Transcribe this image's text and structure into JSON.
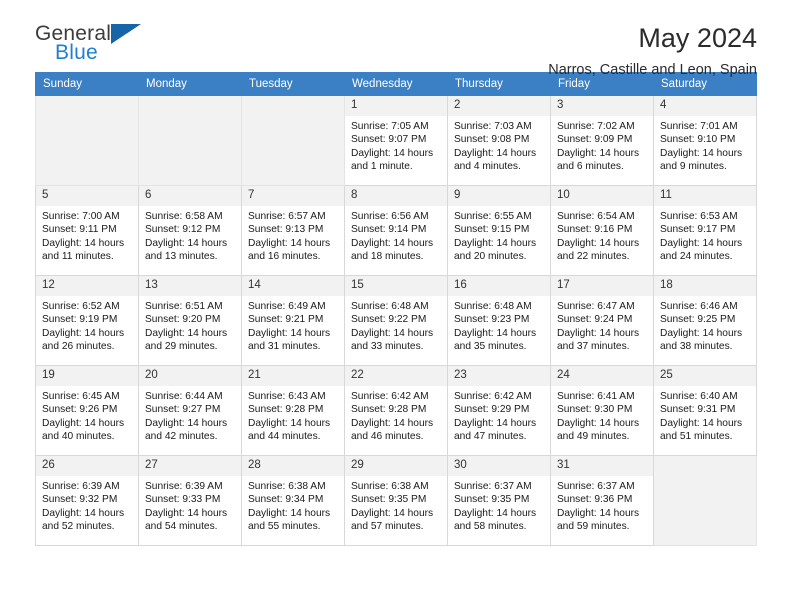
{
  "brand": {
    "name_part1": "General",
    "name_part2": "Blue",
    "logo_icon": "triangle-flag-icon",
    "accent_color": "#1f7fd0",
    "triangle_color": "#1565a8"
  },
  "header": {
    "title": "May 2024",
    "subtitle": "Narros, Castille and Leon, Spain"
  },
  "theme": {
    "header_row_bg": "#3b7fc4",
    "daynum_bg": "#f2f2f2",
    "grid_border": "#d8d8d8"
  },
  "weekday_headers": [
    "Sunday",
    "Monday",
    "Tuesday",
    "Wednesday",
    "Thursday",
    "Friday",
    "Saturday"
  ],
  "weeks": [
    [
      {
        "day": "",
        "empty": true,
        "sunrise": "",
        "sunset": "",
        "daylight_line1": "",
        "daylight_line2": ""
      },
      {
        "day": "",
        "empty": true,
        "sunrise": "",
        "sunset": "",
        "daylight_line1": "",
        "daylight_line2": ""
      },
      {
        "day": "",
        "empty": true,
        "sunrise": "",
        "sunset": "",
        "daylight_line1": "",
        "daylight_line2": ""
      },
      {
        "day": "1",
        "empty": false,
        "sunrise": "Sunrise: 7:05 AM",
        "sunset": "Sunset: 9:07 PM",
        "daylight_line1": "Daylight: 14 hours",
        "daylight_line2": "and 1 minute."
      },
      {
        "day": "2",
        "empty": false,
        "sunrise": "Sunrise: 7:03 AM",
        "sunset": "Sunset: 9:08 PM",
        "daylight_line1": "Daylight: 14 hours",
        "daylight_line2": "and 4 minutes."
      },
      {
        "day": "3",
        "empty": false,
        "sunrise": "Sunrise: 7:02 AM",
        "sunset": "Sunset: 9:09 PM",
        "daylight_line1": "Daylight: 14 hours",
        "daylight_line2": "and 6 minutes."
      },
      {
        "day": "4",
        "empty": false,
        "sunrise": "Sunrise: 7:01 AM",
        "sunset": "Sunset: 9:10 PM",
        "daylight_line1": "Daylight: 14 hours",
        "daylight_line2": "and 9 minutes."
      }
    ],
    [
      {
        "day": "5",
        "empty": false,
        "sunrise": "Sunrise: 7:00 AM",
        "sunset": "Sunset: 9:11 PM",
        "daylight_line1": "Daylight: 14 hours",
        "daylight_line2": "and 11 minutes."
      },
      {
        "day": "6",
        "empty": false,
        "sunrise": "Sunrise: 6:58 AM",
        "sunset": "Sunset: 9:12 PM",
        "daylight_line1": "Daylight: 14 hours",
        "daylight_line2": "and 13 minutes."
      },
      {
        "day": "7",
        "empty": false,
        "sunrise": "Sunrise: 6:57 AM",
        "sunset": "Sunset: 9:13 PM",
        "daylight_line1": "Daylight: 14 hours",
        "daylight_line2": "and 16 minutes."
      },
      {
        "day": "8",
        "empty": false,
        "sunrise": "Sunrise: 6:56 AM",
        "sunset": "Sunset: 9:14 PM",
        "daylight_line1": "Daylight: 14 hours",
        "daylight_line2": "and 18 minutes."
      },
      {
        "day": "9",
        "empty": false,
        "sunrise": "Sunrise: 6:55 AM",
        "sunset": "Sunset: 9:15 PM",
        "daylight_line1": "Daylight: 14 hours",
        "daylight_line2": "and 20 minutes."
      },
      {
        "day": "10",
        "empty": false,
        "sunrise": "Sunrise: 6:54 AM",
        "sunset": "Sunset: 9:16 PM",
        "daylight_line1": "Daylight: 14 hours",
        "daylight_line2": "and 22 minutes."
      },
      {
        "day": "11",
        "empty": false,
        "sunrise": "Sunrise: 6:53 AM",
        "sunset": "Sunset: 9:17 PM",
        "daylight_line1": "Daylight: 14 hours",
        "daylight_line2": "and 24 minutes."
      }
    ],
    [
      {
        "day": "12",
        "empty": false,
        "sunrise": "Sunrise: 6:52 AM",
        "sunset": "Sunset: 9:19 PM",
        "daylight_line1": "Daylight: 14 hours",
        "daylight_line2": "and 26 minutes."
      },
      {
        "day": "13",
        "empty": false,
        "sunrise": "Sunrise: 6:51 AM",
        "sunset": "Sunset: 9:20 PM",
        "daylight_line1": "Daylight: 14 hours",
        "daylight_line2": "and 29 minutes."
      },
      {
        "day": "14",
        "empty": false,
        "sunrise": "Sunrise: 6:49 AM",
        "sunset": "Sunset: 9:21 PM",
        "daylight_line1": "Daylight: 14 hours",
        "daylight_line2": "and 31 minutes."
      },
      {
        "day": "15",
        "empty": false,
        "sunrise": "Sunrise: 6:48 AM",
        "sunset": "Sunset: 9:22 PM",
        "daylight_line1": "Daylight: 14 hours",
        "daylight_line2": "and 33 minutes."
      },
      {
        "day": "16",
        "empty": false,
        "sunrise": "Sunrise: 6:48 AM",
        "sunset": "Sunset: 9:23 PM",
        "daylight_line1": "Daylight: 14 hours",
        "daylight_line2": "and 35 minutes."
      },
      {
        "day": "17",
        "empty": false,
        "sunrise": "Sunrise: 6:47 AM",
        "sunset": "Sunset: 9:24 PM",
        "daylight_line1": "Daylight: 14 hours",
        "daylight_line2": "and 37 minutes."
      },
      {
        "day": "18",
        "empty": false,
        "sunrise": "Sunrise: 6:46 AM",
        "sunset": "Sunset: 9:25 PM",
        "daylight_line1": "Daylight: 14 hours",
        "daylight_line2": "and 38 minutes."
      }
    ],
    [
      {
        "day": "19",
        "empty": false,
        "sunrise": "Sunrise: 6:45 AM",
        "sunset": "Sunset: 9:26 PM",
        "daylight_line1": "Daylight: 14 hours",
        "daylight_line2": "and 40 minutes."
      },
      {
        "day": "20",
        "empty": false,
        "sunrise": "Sunrise: 6:44 AM",
        "sunset": "Sunset: 9:27 PM",
        "daylight_line1": "Daylight: 14 hours",
        "daylight_line2": "and 42 minutes."
      },
      {
        "day": "21",
        "empty": false,
        "sunrise": "Sunrise: 6:43 AM",
        "sunset": "Sunset: 9:28 PM",
        "daylight_line1": "Daylight: 14 hours",
        "daylight_line2": "and 44 minutes."
      },
      {
        "day": "22",
        "empty": false,
        "sunrise": "Sunrise: 6:42 AM",
        "sunset": "Sunset: 9:28 PM",
        "daylight_line1": "Daylight: 14 hours",
        "daylight_line2": "and 46 minutes."
      },
      {
        "day": "23",
        "empty": false,
        "sunrise": "Sunrise: 6:42 AM",
        "sunset": "Sunset: 9:29 PM",
        "daylight_line1": "Daylight: 14 hours",
        "daylight_line2": "and 47 minutes."
      },
      {
        "day": "24",
        "empty": false,
        "sunrise": "Sunrise: 6:41 AM",
        "sunset": "Sunset: 9:30 PM",
        "daylight_line1": "Daylight: 14 hours",
        "daylight_line2": "and 49 minutes."
      },
      {
        "day": "25",
        "empty": false,
        "sunrise": "Sunrise: 6:40 AM",
        "sunset": "Sunset: 9:31 PM",
        "daylight_line1": "Daylight: 14 hours",
        "daylight_line2": "and 51 minutes."
      }
    ],
    [
      {
        "day": "26",
        "empty": false,
        "sunrise": "Sunrise: 6:39 AM",
        "sunset": "Sunset: 9:32 PM",
        "daylight_line1": "Daylight: 14 hours",
        "daylight_line2": "and 52 minutes."
      },
      {
        "day": "27",
        "empty": false,
        "sunrise": "Sunrise: 6:39 AM",
        "sunset": "Sunset: 9:33 PM",
        "daylight_line1": "Daylight: 14 hours",
        "daylight_line2": "and 54 minutes."
      },
      {
        "day": "28",
        "empty": false,
        "sunrise": "Sunrise: 6:38 AM",
        "sunset": "Sunset: 9:34 PM",
        "daylight_line1": "Daylight: 14 hours",
        "daylight_line2": "and 55 minutes."
      },
      {
        "day": "29",
        "empty": false,
        "sunrise": "Sunrise: 6:38 AM",
        "sunset": "Sunset: 9:35 PM",
        "daylight_line1": "Daylight: 14 hours",
        "daylight_line2": "and 57 minutes."
      },
      {
        "day": "30",
        "empty": false,
        "sunrise": "Sunrise: 6:37 AM",
        "sunset": "Sunset: 9:35 PM",
        "daylight_line1": "Daylight: 14 hours",
        "daylight_line2": "and 58 minutes."
      },
      {
        "day": "31",
        "empty": false,
        "sunrise": "Sunrise: 6:37 AM",
        "sunset": "Sunset: 9:36 PM",
        "daylight_line1": "Daylight: 14 hours",
        "daylight_line2": "and 59 minutes."
      },
      {
        "day": "",
        "empty": true,
        "sunrise": "",
        "sunset": "",
        "daylight_line1": "",
        "daylight_line2": ""
      }
    ]
  ]
}
